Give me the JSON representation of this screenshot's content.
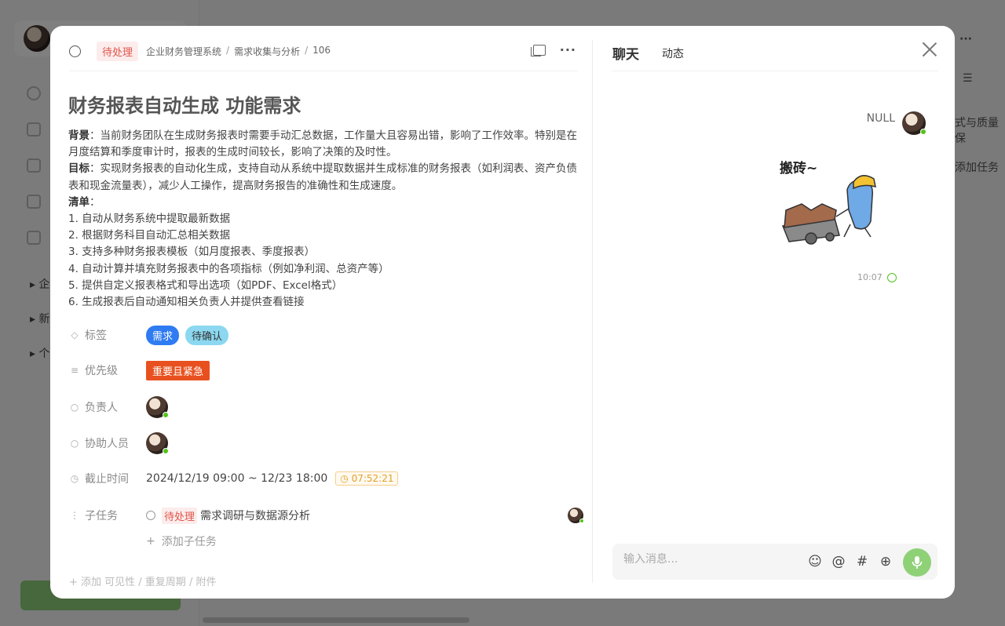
{
  "background": {
    "tree_items": [
      "企",
      "新",
      "个"
    ],
    "right_fragments": [
      "式与质量保",
      "添加任务"
    ]
  },
  "header": {
    "status": "待处理",
    "breadcrumb": [
      "企业财务管理系统",
      "需求收集与分析",
      "106"
    ]
  },
  "task": {
    "title": "财务报表自动生成 功能需求",
    "background_label": "背景",
    "background_text": "：当前财务团队在生成财务报表时需要手动汇总数据，工作量大且容易出错，影响了工作效率。特别是在月度结算和季度审计时，报表的生成时间较长，影响了决策的及时性。",
    "goal_label": "目标",
    "goal_text": "：实现财务报表的自动化生成，支持自动从系统中提取数据并生成标准的财务报表（如利润表、资产负债表和现金流量表），减少人工操作，提高财务报告的准确性和生成速度。",
    "list_label": "清单",
    "list_colon": "：",
    "list": [
      "1. 自动从财务系统中提取最新数据",
      "2. 根据财务科目自动汇总相关数据",
      "3. 支持多种财务报表模板（如月度报表、季度报表）",
      "4. 自动计算并填充财务报表中的各项指标（例如净利润、总资产等）",
      "5. 提供自定义报表格式和导出选项（如PDF、Excel格式）",
      "6. 生成报表后自动通知相关负责人并提供查看链接"
    ]
  },
  "fields": {
    "tags_label": "标签",
    "tags": [
      "需求",
      "待确认"
    ],
    "priority_label": "优先级",
    "priority": "重要且紧急",
    "owner_label": "负责人",
    "collab_label": "协助人员",
    "deadline_label": "截止时间",
    "deadline": "2024/12/19 09:00 ~ 12/23 18:00",
    "timer": "07:52:21",
    "subtask_label": "子任务",
    "subtask_status": "待处理",
    "subtask_name": "需求调研与数据源分析",
    "add_subtask": "添加子任务",
    "more": "添加 可见性 / 重复周期 / 附件"
  },
  "chat": {
    "tab_chat": "聊天",
    "tab_activity": "动态",
    "sender": "NULL",
    "sticker_text": "搬砖~",
    "time": "10:07",
    "input_placeholder": "输入消息..."
  },
  "colors": {
    "status_red": "#e0554a",
    "tag_blue": "#2f7bf2",
    "tag_cyan": "#8bd8f0",
    "priority_red": "#e8511f",
    "online_green": "#52c41a",
    "mic_green": "#8fd177",
    "timer_orange": "#e39f29"
  }
}
